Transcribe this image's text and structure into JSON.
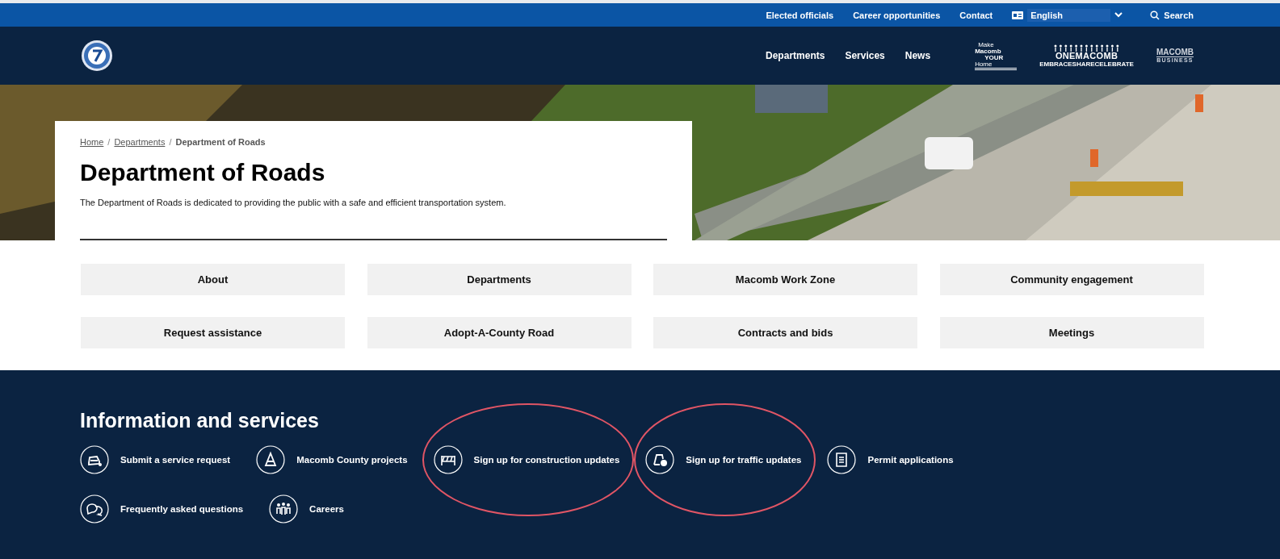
{
  "utility_nav": {
    "links": [
      "Elected officials",
      "Career opportunities",
      "Contact"
    ],
    "language": {
      "value": "English"
    },
    "search": "Search"
  },
  "main_nav": {
    "links": [
      "Departments",
      "Services",
      "News"
    ],
    "logos": [
      {
        "kind": "home",
        "lines": [
          "Make",
          "Macomb",
          "YOUR",
          "Home"
        ]
      },
      {
        "kind": "one",
        "lines": [
          "ONEMACOMB",
          "EMBRACESHARECELEBRATE"
        ]
      },
      {
        "kind": "business",
        "lines": [
          "MACOMB",
          "BUSINESS"
        ]
      }
    ]
  },
  "breadcrumb": [
    {
      "label": "Home",
      "link": true
    },
    {
      "separator": "/",
      "label": "Departments",
      "link": true
    },
    {
      "separator": "/",
      "label": "Department of Roads",
      "link": false
    }
  ],
  "title": "Department of Roads",
  "intro": "The Department of Roads is dedicated to providing the public with a safe and efficient transportation system.",
  "quick_links": [
    "About",
    "Departments",
    "Macomb Work Zone",
    "Community engagement",
    "Request assistance",
    "Adopt-A-County Road",
    "Contracts and bids",
    "Meetings"
  ],
  "info_section": {
    "heading": "Information and services",
    "items": [
      {
        "label": "Submit a service request",
        "kind": "car",
        "circled": false
      },
      {
        "label": "Macomb County projects",
        "kind": "cone",
        "circled": false
      },
      {
        "label": "Sign up for construction updates",
        "kind": "barrier",
        "circled": true
      },
      {
        "label": "Sign up for traffic updates",
        "kind": "alert",
        "circled": true
      },
      {
        "label": "Permit applications",
        "kind": "list",
        "circled": false
      },
      {
        "label": "Frequently asked questions",
        "kind": "chat",
        "circled": false
      },
      {
        "label": "Careers",
        "kind": "people",
        "circled": false
      }
    ]
  }
}
